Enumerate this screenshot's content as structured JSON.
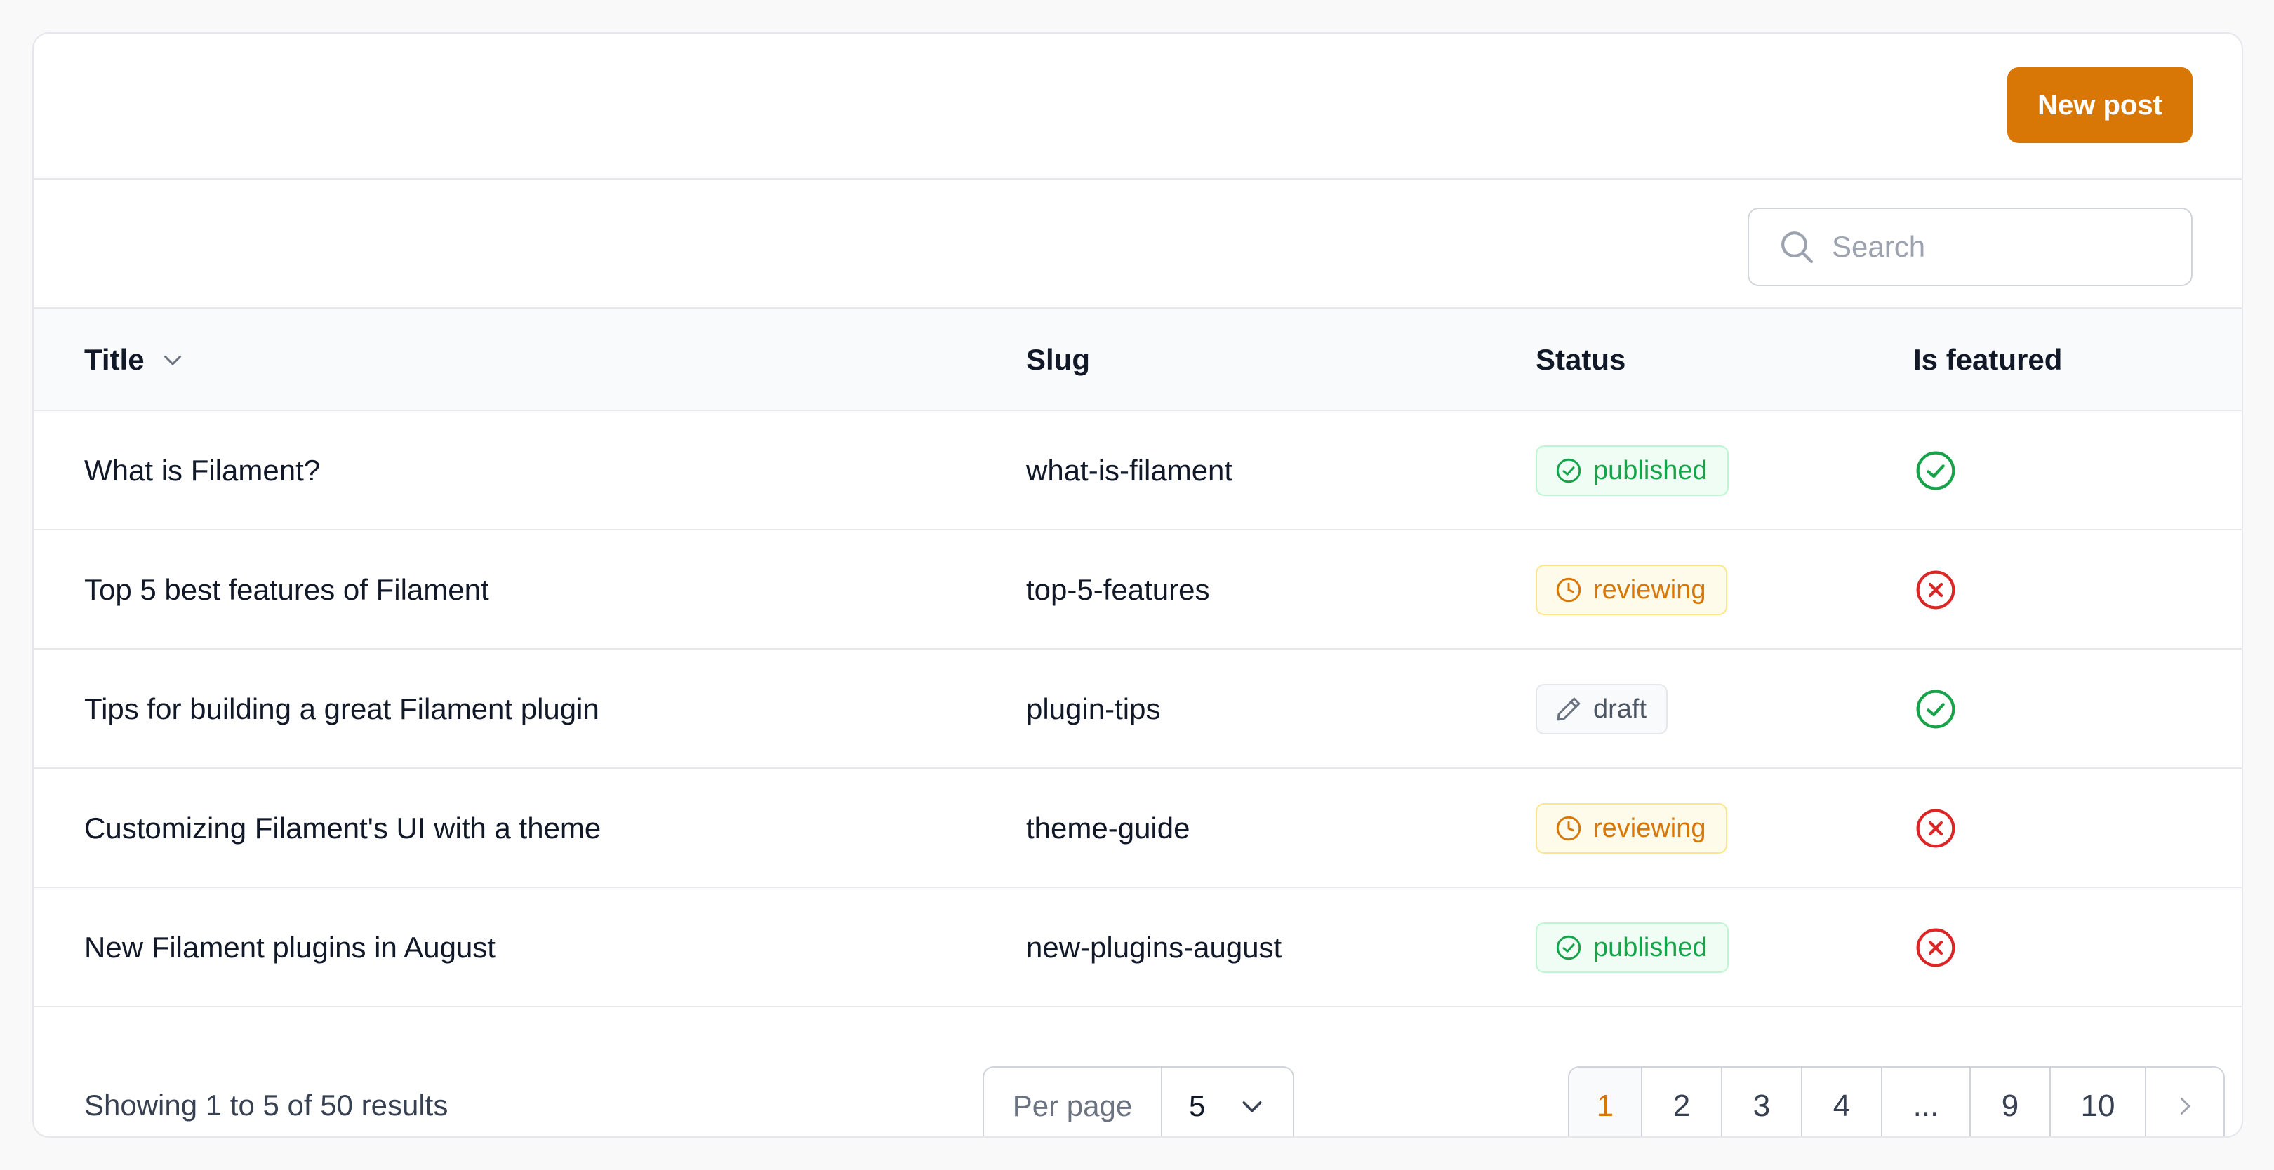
{
  "header": {
    "new_post_label": "New post"
  },
  "search": {
    "placeholder": "Search"
  },
  "table": {
    "columns": {
      "title": "Title",
      "slug": "Slug",
      "status": "Status",
      "featured": "Is featured"
    },
    "rows": [
      {
        "title": "What is Filament?",
        "slug": "what-is-filament",
        "status": "published",
        "featured": true
      },
      {
        "title": "Top 5 best features of Filament",
        "slug": "top-5-features",
        "status": "reviewing",
        "featured": false
      },
      {
        "title": "Tips for building a great Filament plugin",
        "slug": "plugin-tips",
        "status": "draft",
        "featured": true
      },
      {
        "title": "Customizing Filament's UI with a theme",
        "slug": "theme-guide",
        "status": "reviewing",
        "featured": false
      },
      {
        "title": "New Filament plugins in August",
        "slug": "new-plugins-august",
        "status": "published",
        "featured": false
      }
    ]
  },
  "footer": {
    "summary": "Showing 1 to 5 of 50 results",
    "per_page_label": "Per page",
    "per_page_value": "5",
    "pages": [
      "1",
      "2",
      "3",
      "4",
      "...",
      "9",
      "10"
    ],
    "current_page": "1"
  },
  "colors": {
    "accent": "#d97706",
    "success": "#16a34a",
    "danger": "#dc2626"
  }
}
